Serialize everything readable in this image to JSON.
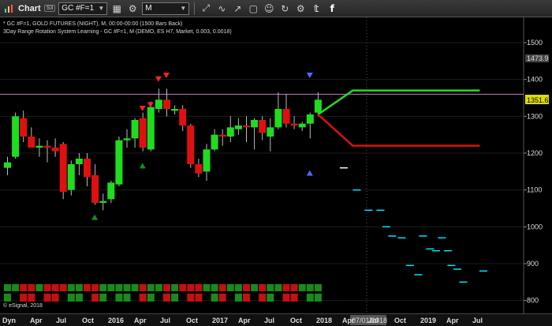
{
  "toolbar": {
    "title": "Chart",
    "badge": "S3",
    "symbol": "GC #F=1",
    "interval": "M",
    "icons": [
      "chart-icon",
      "link-icon",
      "settings-icon",
      "cursor-icon",
      "draw-icon",
      "magnet-icon",
      "shapes-icon",
      "text-icon",
      "reload-icon",
      "settings2-icon",
      "twitter-icon",
      "facebook-icon"
    ]
  },
  "chart": {
    "info_line1": "* GC #F=1, GOLD FUTURES (NIGHT), M, 00:00-00:00 (1500 Bars Back)",
    "info_line2": "3Day Range Rotation System Learning - GC #F=1, M (DEMO, ES H7, Market, 0.003, 0.0018)",
    "watermark": "© eSignal, 2018",
    "price_labels": {
      "upper": "1473.9",
      "current": "1351.6"
    },
    "colors": {
      "bull": "#1fdc1f",
      "bear": "#e01010",
      "lavender": "#c080c0",
      "cyan": "#00e5ff",
      "projection_up": "#22dd22",
      "projection_down": "#dd1111"
    }
  },
  "bottombar": {
    "mode": "Dyn",
    "cursor_date": "07/01/2018",
    "x_labels": [
      "Apr",
      "Jul",
      "Oct",
      "2016",
      "Apr",
      "Jul",
      "Oct",
      "2017",
      "Apr",
      "Jul",
      "Oct",
      "2018",
      "Apr",
      "Jul",
      "Oct",
      "2019",
      "Apr",
      "Jul"
    ]
  },
  "chart_data": {
    "type": "candlestick",
    "title": "GC #F=1, GOLD FUTURES (NIGHT), M",
    "y_ticks": [
      800,
      900,
      1000,
      1100,
      1200,
      1300,
      1400,
      1500
    ],
    "ylim": [
      765,
      1560
    ],
    "horizontal_line": 1360,
    "candles": [
      {
        "o": 1160,
        "h": 1190,
        "l": 1140,
        "c": 1175
      },
      {
        "o": 1190,
        "h": 1310,
        "l": 1185,
        "c": 1300
      },
      {
        "o": 1295,
        "h": 1315,
        "l": 1230,
        "c": 1245
      },
      {
        "o": 1245,
        "h": 1270,
        "l": 1215,
        "c": 1215
      },
      {
        "o": 1215,
        "h": 1240,
        "l": 1190,
        "c": 1220
      },
      {
        "o": 1220,
        "h": 1235,
        "l": 1175,
        "c": 1215
      },
      {
        "o": 1215,
        "h": 1240,
        "l": 1190,
        "c": 1205
      },
      {
        "o": 1225,
        "h": 1230,
        "l": 1075,
        "c": 1095
      },
      {
        "o": 1100,
        "h": 1180,
        "l": 1085,
        "c": 1170
      },
      {
        "o": 1170,
        "h": 1200,
        "l": 1140,
        "c": 1185
      },
      {
        "o": 1185,
        "h": 1200,
        "l": 1110,
        "c": 1135
      },
      {
        "o": 1140,
        "h": 1170,
        "l": 1060,
        "c": 1065
      },
      {
        "o": 1065,
        "h": 1090,
        "l": 1045,
        "c": 1070
      },
      {
        "o": 1075,
        "h": 1125,
        "l": 1065,
        "c": 1120
      },
      {
        "o": 1115,
        "h": 1245,
        "l": 1110,
        "c": 1235
      },
      {
        "o": 1235,
        "h": 1265,
        "l": 1215,
        "c": 1240
      },
      {
        "o": 1240,
        "h": 1295,
        "l": 1215,
        "c": 1290
      },
      {
        "o": 1295,
        "h": 1310,
        "l": 1205,
        "c": 1215
      },
      {
        "o": 1210,
        "h": 1340,
        "l": 1205,
        "c": 1325
      },
      {
        "o": 1320,
        "h": 1375,
        "l": 1310,
        "c": 1345
      },
      {
        "o": 1345,
        "h": 1375,
        "l": 1300,
        "c": 1320
      },
      {
        "o": 1315,
        "h": 1330,
        "l": 1305,
        "c": 1320
      },
      {
        "o": 1320,
        "h": 1330,
        "l": 1260,
        "c": 1275
      },
      {
        "o": 1275,
        "h": 1280,
        "l": 1160,
        "c": 1170
      },
      {
        "o": 1170,
        "h": 1185,
        "l": 1135,
        "c": 1145
      },
      {
        "o": 1150,
        "h": 1225,
        "l": 1125,
        "c": 1210
      },
      {
        "o": 1210,
        "h": 1265,
        "l": 1205,
        "c": 1250
      },
      {
        "o": 1250,
        "h": 1265,
        "l": 1220,
        "c": 1245
      },
      {
        "o": 1245,
        "h": 1300,
        "l": 1230,
        "c": 1270
      },
      {
        "o": 1265,
        "h": 1295,
        "l": 1250,
        "c": 1275
      },
      {
        "o": 1275,
        "h": 1300,
        "l": 1230,
        "c": 1270
      },
      {
        "o": 1270,
        "h": 1295,
        "l": 1210,
        "c": 1290
      },
      {
        "o": 1290,
        "h": 1300,
        "l": 1235,
        "c": 1255
      },
      {
        "o": 1245,
        "h": 1295,
        "l": 1205,
        "c": 1270
      },
      {
        "o": 1270,
        "h": 1365,
        "l": 1265,
        "c": 1320
      },
      {
        "o": 1320,
        "h": 1360,
        "l": 1270,
        "c": 1280
      },
      {
        "o": 1280,
        "h": 1300,
        "l": 1265,
        "c": 1275
      },
      {
        "o": 1270,
        "h": 1285,
        "l": 1260,
        "c": 1280
      },
      {
        "o": 1280,
        "h": 1310,
        "l": 1240,
        "c": 1305
      },
      {
        "o": 1310,
        "h": 1365,
        "l": 1300,
        "c": 1345
      }
    ],
    "projection_up": [
      [
        1305,
        0
      ],
      [
        1370,
        3
      ],
      [
        1370,
        14
      ]
    ],
    "projection_down": [
      [
        1305,
        0
      ],
      [
        1220,
        3
      ],
      [
        1220,
        14
      ]
    ],
    "forecast_marks": [
      [
        1160,
        0.5
      ],
      [
        1100,
        1.6
      ],
      [
        1045,
        2.6
      ],
      [
        1045,
        3.6
      ],
      [
        1000,
        4.1
      ],
      [
        975,
        4.6
      ],
      [
        970,
        5.4
      ],
      [
        895,
        6.1
      ],
      [
        870,
        6.8
      ],
      [
        975,
        7.2
      ],
      [
        940,
        7.8
      ],
      [
        935,
        8.3
      ],
      [
        970,
        8.8
      ],
      [
        935,
        9.3
      ],
      [
        895,
        9.6
      ],
      [
        885,
        10.1
      ],
      [
        850,
        10.6
      ],
      [
        880,
        12.3
      ]
    ]
  }
}
